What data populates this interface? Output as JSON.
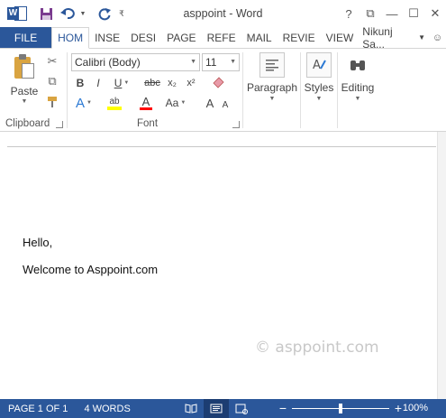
{
  "window": {
    "title": "asppoint - Word",
    "controls": {
      "help": "?",
      "restore_ribbon": "⧉",
      "minimize": "—",
      "maximize": "☐",
      "close": "✕"
    }
  },
  "quick_access": {
    "app_icon": "W",
    "save_icon": "save-icon",
    "undo_icon": "undo-icon",
    "redo_icon": "redo-icon"
  },
  "tabs": {
    "file": "FILE",
    "items": [
      "HOM",
      "INSE",
      "DESI",
      "PAGE",
      "REFE",
      "MAIL",
      "REVIE",
      "VIEW"
    ],
    "active_index": 0,
    "user": "Nikunj Sa..."
  },
  "ribbon": {
    "clipboard": {
      "paste_label": "Paste",
      "group_label": "Clipboard"
    },
    "font": {
      "font_name": "Calibri (Body)",
      "font_size": "11",
      "bold": "B",
      "italic": "I",
      "underline": "U",
      "strike": "abc",
      "subscript": "x₂",
      "superscript": "x²",
      "text_effects": "A",
      "highlight": "ab",
      "font_color": "A",
      "change_case": "Aa",
      "grow": "A",
      "shrink": "A",
      "group_label": "Font"
    },
    "paragraph": {
      "label": "Paragraph"
    },
    "styles": {
      "label": "Styles"
    },
    "editing": {
      "label": "Editing"
    },
    "colors": {
      "accent": "#2b579a",
      "highlight": "#ffff00",
      "font_color": "#ff0000"
    }
  },
  "document": {
    "lines": [
      "Hello,",
      "Welcome to Asppoint.com"
    ],
    "watermark": "© asppoint.com"
  },
  "status": {
    "page": "PAGE 1 OF 1",
    "words": "4 WORDS",
    "zoom_minus": "−",
    "zoom_plus": "+",
    "zoom": "100%",
    "zoom_level_percent": 100
  }
}
